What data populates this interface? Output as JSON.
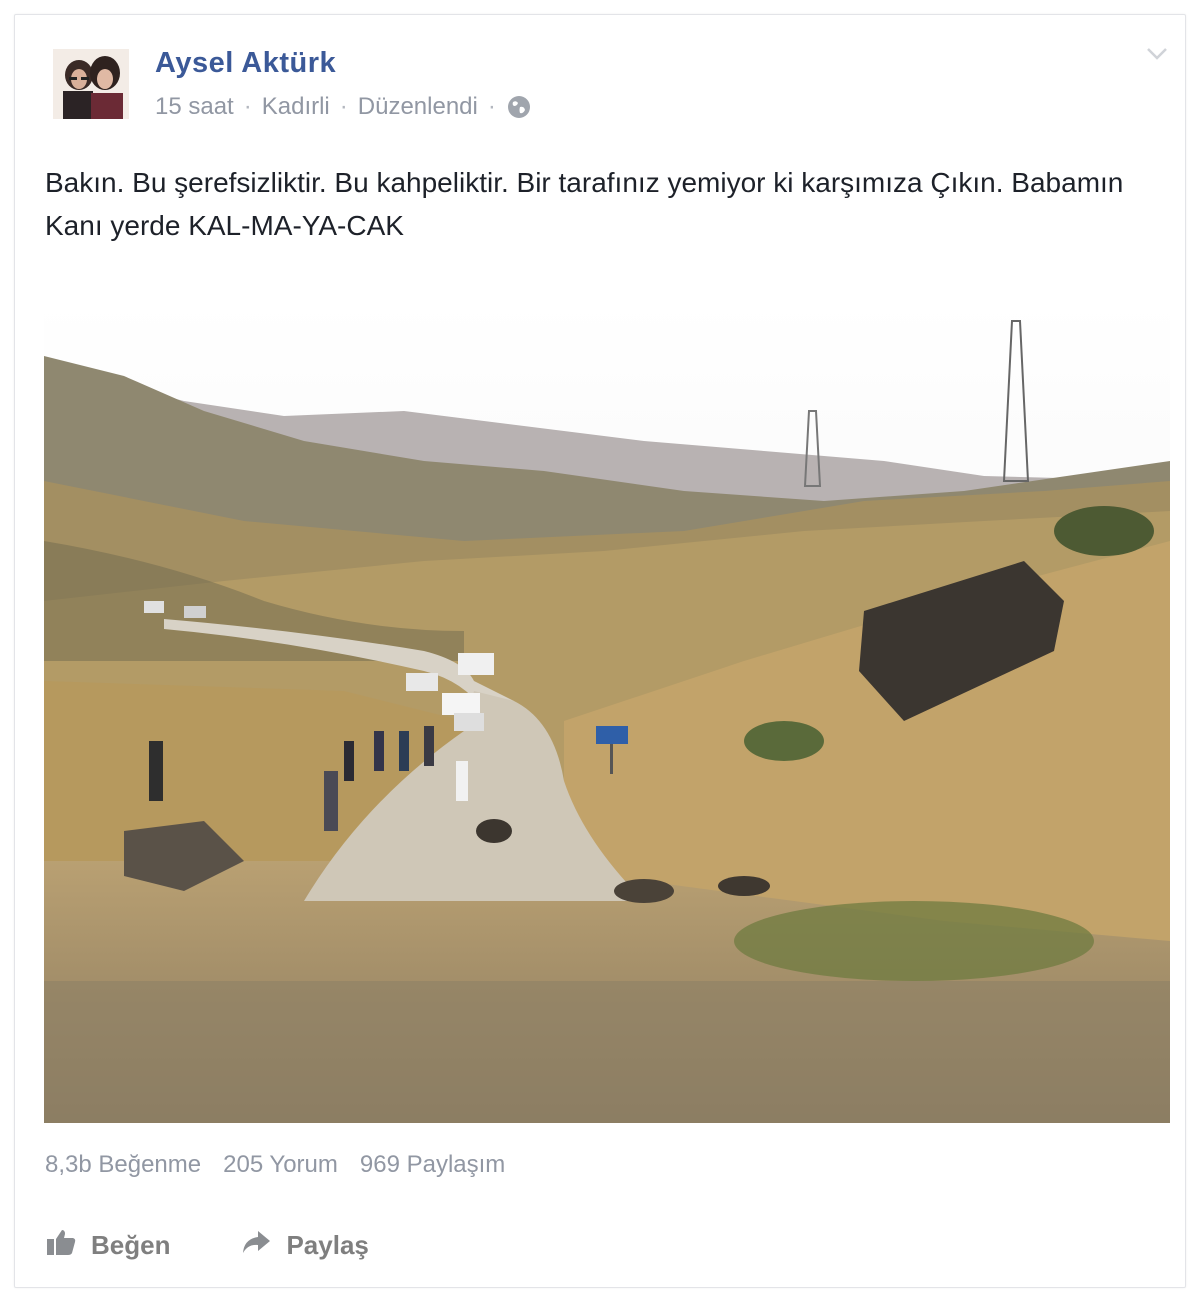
{
  "post": {
    "author": "Aysel Aktürk",
    "meta": {
      "time": "15 saat",
      "location": "Kadırli",
      "edited": "Düzenlendi",
      "separator": "·",
      "privacy_icon": "globe-icon"
    },
    "text": "Bakın. Bu şerefsizliktir. Bu kahpeliktir. Bir tarafınız yemiyor ki karşımıza Çıkın. Babamın Kanı yerde KAL-MA-YA-CAK"
  },
  "stats": {
    "likes": "8,3b Beğenme",
    "comments": "205 Yorum",
    "shares": "969 Paylaşım"
  },
  "actions": {
    "like_label": "Beğen",
    "share_label": "Paylaş",
    "like_icon": "thumbs-up-icon",
    "share_icon": "share-arrow-icon"
  },
  "colors": {
    "author": "#3b5998",
    "meta": "#9197a3",
    "text": "#1d2129"
  }
}
